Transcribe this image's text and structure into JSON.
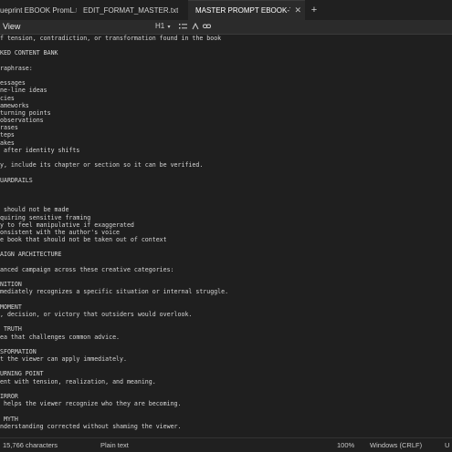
{
  "tabs": [
    {
      "label": "ueprint EBOOK PromL.txt"
    },
    {
      "label": "EDIT_FORMAT_MASTER.txt"
    },
    {
      "label": "MASTER PROMPT EBOOK-TO",
      "close": "✕",
      "active": true
    }
  ],
  "new_tab": "+",
  "menu": {
    "view": "View"
  },
  "toolbar": {
    "heading": "H1",
    "heading_chevron": "▾"
  },
  "editor": {
    "lines": [
      "f tension, contradiction, or transformation found in the book",
      "",
      "KED CONTENT BANK",
      "",
      "raphrase:",
      "",
      "essages",
      "ne-line ideas",
      "cies",
      "ameworks",
      "turning points",
      "observations",
      "rases",
      "teps",
      "akes",
      " after identity shifts",
      "",
      "y, include its chapter or section so it can be verified.",
      "",
      "UARDRAILS",
      "",
      "",
      "",
      " should not be made",
      "quiring sensitive framing",
      "y to feel manipulative if exaggerated",
      "onsistent with the author's voice",
      "e book that should not be taken out of context",
      "",
      "AIGN ARCHITECTURE",
      "",
      "anced campaign across these creative categories:",
      "",
      "NITION",
      "mediately recognizes a specific situation or internal struggle.",
      "",
      "MOMENT",
      ", decision, or victory that outsiders would overlook.",
      "",
      " TRUTH",
      "ea that challenges common advice.",
      "",
      "SFORMATION",
      "t the viewer can apply immediately.",
      "",
      "URNING POINT",
      "ent with tension, realization, and meaning.",
      "",
      "IRROR",
      " helps the viewer recognize who they are becoming.",
      "",
      " MYTH",
      "nderstanding corrected without shaming the viewer.",
      ""
    ]
  },
  "status": {
    "char_count": "15,766 characters",
    "format": "Plain text",
    "zoom": "100%",
    "line_ending": "Windows (CRLF)",
    "encoding_partial": "U"
  }
}
